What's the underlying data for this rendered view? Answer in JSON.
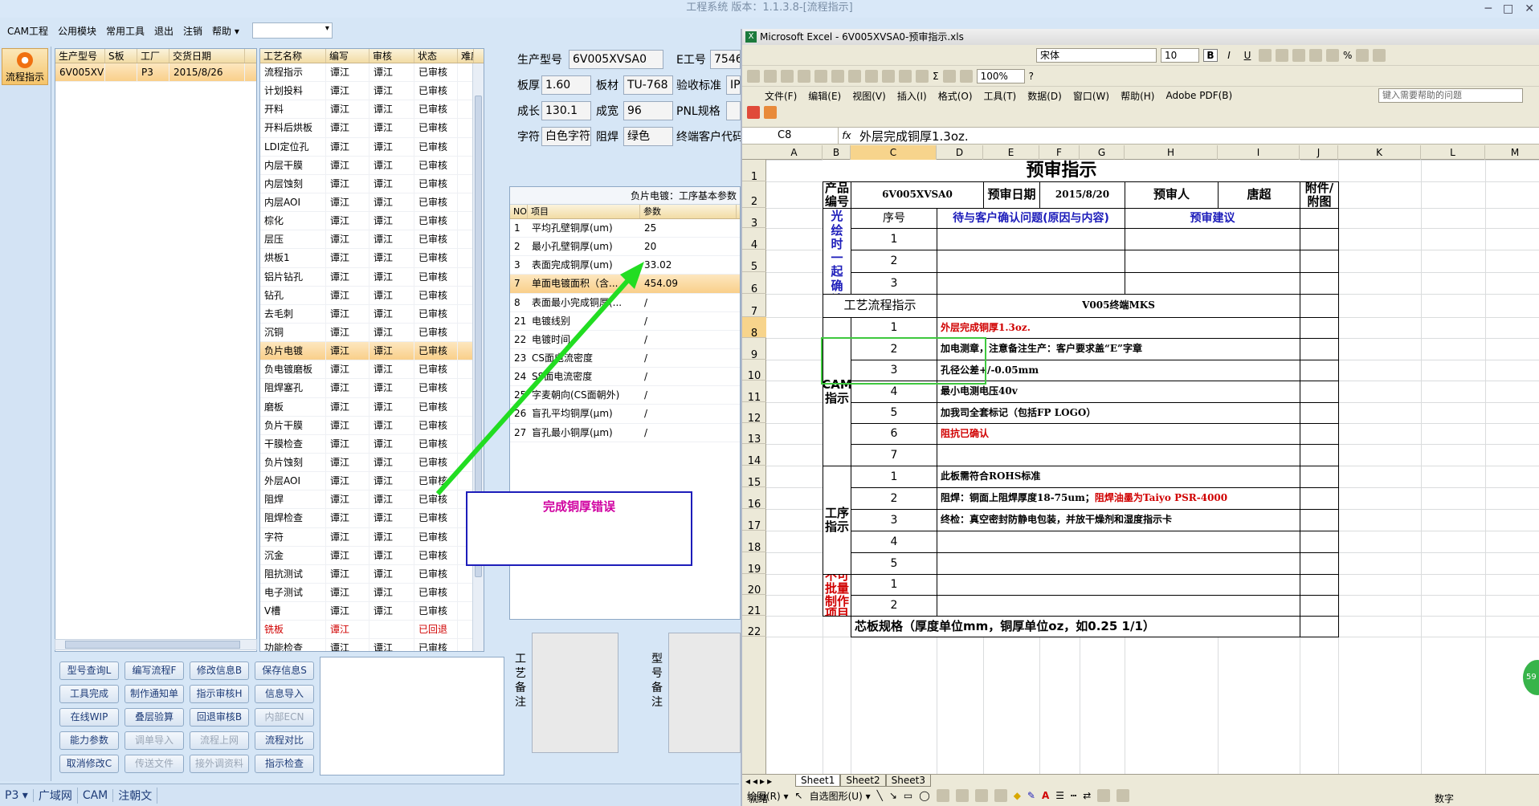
{
  "app": {
    "title": "工程系统 版本：1.1.3.8-[流程指示]",
    "menu": [
      "CAM工程",
      "公用模块",
      "常用工具",
      "退出",
      "注销",
      "帮助 ▾"
    ],
    "dropdown_value": "",
    "nav_button": "流程指示"
  },
  "product_grid": {
    "headers": [
      "生产型号",
      "S板",
      "工厂",
      "交货日期"
    ],
    "rows": [
      [
        "6V005XVSA0",
        "",
        "P3",
        "2015/8/26"
      ]
    ]
  },
  "process_grid": {
    "headers": [
      "工艺名称",
      "编写",
      "审核",
      "状态",
      "难度"
    ],
    "rows": [
      [
        "流程指示",
        "谭江",
        "谭江",
        "已审核"
      ],
      [
        "计划投料",
        "谭江",
        "谭江",
        "已审核"
      ],
      [
        "开料",
        "谭江",
        "谭江",
        "已审核"
      ],
      [
        "开料后烘板",
        "谭江",
        "谭江",
        "已审核"
      ],
      [
        "LDI定位孔",
        "谭江",
        "谭江",
        "已审核"
      ],
      [
        "内层干膜",
        "谭江",
        "谭江",
        "已审核"
      ],
      [
        "内层蚀刻",
        "谭江",
        "谭江",
        "已审核"
      ],
      [
        "内层AOI",
        "谭江",
        "谭江",
        "已审核"
      ],
      [
        "棕化",
        "谭江",
        "谭江",
        "已审核"
      ],
      [
        "层压",
        "谭江",
        "谭江",
        "已审核"
      ],
      [
        "烘板1",
        "谭江",
        "谭江",
        "已审核"
      ],
      [
        "铝片钻孔",
        "谭江",
        "谭江",
        "已审核"
      ],
      [
        "钻孔",
        "谭江",
        "谭江",
        "已审核"
      ],
      [
        "去毛刺",
        "谭江",
        "谭江",
        "已审核"
      ],
      [
        "沉铜",
        "谭江",
        "谭江",
        "已审核"
      ],
      [
        "负片电镀",
        "谭江",
        "谭江",
        "已审核"
      ],
      [
        "负电镀磨板",
        "谭江",
        "谭江",
        "已审核"
      ],
      [
        "阻焊塞孔",
        "谭江",
        "谭江",
        "已审核"
      ],
      [
        "磨板",
        "谭江",
        "谭江",
        "已审核"
      ],
      [
        "负片干膜",
        "谭江",
        "谭江",
        "已审核"
      ],
      [
        "干膜检查",
        "谭江",
        "谭江",
        "已审核"
      ],
      [
        "负片蚀刻",
        "谭江",
        "谭江",
        "已审核"
      ],
      [
        "外层AOI",
        "谭江",
        "谭江",
        "已审核"
      ],
      [
        "阻焊",
        "谭江",
        "谭江",
        "已审核"
      ],
      [
        "阻焊检查",
        "谭江",
        "谭江",
        "已审核"
      ],
      [
        "字符",
        "谭江",
        "谭江",
        "已审核"
      ],
      [
        "沉金",
        "谭江",
        "谭江",
        "已审核"
      ],
      [
        "阻抗测试",
        "谭江",
        "谭江",
        "已审核"
      ],
      [
        "电子测试",
        "谭江",
        "谭江",
        "已审核"
      ],
      [
        "V槽",
        "谭江",
        "谭江",
        "已审核"
      ],
      [
        "铣板",
        "谭江",
        "",
        "已回退"
      ],
      [
        "功能检查",
        "谭江",
        "谭江",
        "已审核"
      ]
    ],
    "selected_index": 15,
    "red_index": 30
  },
  "buttons": [
    [
      "型号查询L",
      "编写流程F",
      "修改信息B",
      "保存信息S"
    ],
    [
      "工具完成",
      "制作通知单",
      "指示审核H",
      "信息导入"
    ],
    [
      "在线WIP",
      "叠层验算",
      "回退审核B",
      "内部ECN"
    ],
    [
      "能力参数",
      "调单导入",
      "流程上网",
      "流程对比"
    ],
    [
      "取消修改C",
      "传送文件",
      "接外调资料",
      "指示检查"
    ]
  ],
  "form": {
    "labels": {
      "model": "生产型号",
      "eno": "E工号",
      "thick": "板厚",
      "mat": "板材",
      "std": "验收标准",
      "len": "成长",
      "wid": "成宽",
      "pnl": "PNL规格",
      "char": "字符",
      "mask": "阻焊",
      "cust": "终端客户代码"
    },
    "values": {
      "model": "6V005XVSA0",
      "eno": "7546",
      "thick": "1.60",
      "mat": "TU-768",
      "std": "IP",
      "len": "130.1",
      "wid": "96",
      "pnl": "",
      "char": "白色字符",
      "mask": "绿色"
    }
  },
  "params": {
    "caption": "负片电镀：工序基本参数",
    "headers": [
      "NO",
      "项目",
      "参数"
    ],
    "rows": [
      [
        "1",
        "平均孔壁铜厚(um)",
        "25"
      ],
      [
        "2",
        "最小孔壁铜厚(um)",
        "20"
      ],
      [
        "3",
        "表面完成铜厚(um)",
        "33.02"
      ],
      [
        "7",
        "单面电镀面积（含...",
        "454.09"
      ],
      [
        "8",
        "表面最小完成铜厚(...",
        "/"
      ],
      [
        "21",
        "电镀线别",
        "/"
      ],
      [
        "22",
        "电镀时间",
        "/"
      ],
      [
        "23",
        "CS面电流密度",
        "/"
      ],
      [
        "24",
        "SS面电流密度",
        "/"
      ],
      [
        "25",
        "字麦朝向(CS面朝外)",
        "/"
      ],
      [
        "26",
        "盲孔平均铜厚(μm)",
        "/"
      ],
      [
        "27",
        "盲孔最小铜厚(μm)",
        "/"
      ]
    ],
    "selected_index": 3
  },
  "notes": {
    "process_label": "工艺备注",
    "model_label": "型号备注"
  },
  "statusbar": [
    "P3 ▾",
    "广域网",
    "CAM",
    "注朝文"
  ],
  "callout": "完成铜厚错误",
  "excel": {
    "title": "Microsoft Excel - 6V005XVSA0-预审指示.xls",
    "font": "宋体",
    "size": "10",
    "zoom": "100%",
    "help_placeholder": "键入需要帮助的问题",
    "menu": [
      "文件(F)",
      "编辑(E)",
      "视图(V)",
      "插入(I)",
      "格式(O)",
      "工具(T)",
      "数据(D)",
      "窗口(W)",
      "帮助(H)",
      "Adobe PDF(B)"
    ],
    "cell_ref": "C8",
    "formula": "外层完成铜厚1.3oz.",
    "columns": [
      "A",
      "B",
      "C",
      "D",
      "E",
      "F",
      "G",
      "H",
      "I",
      "J",
      "K",
      "L",
      "M"
    ],
    "rows": [
      "1",
      "2",
      "3",
      "4",
      "5",
      "6",
      "7",
      "8",
      "9",
      "10",
      "11",
      "12",
      "13",
      "14",
      "15",
      "16",
      "17",
      "18",
      "19",
      "20",
      "21",
      "22"
    ],
    "sheet_title": "预审指示",
    "h_product": "产品编号",
    "product_no": "6V005XVSA0",
    "h_date": "预审日期",
    "date": "2015/8/20",
    "h_person": "预审人",
    "person": "唐超",
    "h_attach": "附件/附图",
    "h_seq": "序号",
    "h_question": "待与客户确认问题(原因与内容)",
    "h_suggest": "预审建议",
    "confirm_label": "待确认光绘时一起确认问题",
    "flow_label": "工艺流程指示",
    "flow_value": "V005终端MKS",
    "cam_label": "CAM指示",
    "cam_items": [
      "外层完成铜厚1.3oz.",
      "加电测章，注意备注生产：客户要求盖“E”字章",
      "孔径公差+/-0.05mm",
      "最小电测电压40v",
      "加我司全套标记（包括FP LOGO）",
      "阻抗已确认",
      ""
    ],
    "proc_label": "工序指示",
    "proc_items": [
      "此板需符合ROHS标准",
      "阻焊：铜面上阻焊厚度18-75um；",
      "检：真空密封防静电包装，并放干燥剂和湿度指示卡",
      "",
      ""
    ],
    "proc_item2_red": "阻焊油墨为Taiyo PSR-4000",
    "proc_item3_prefix": "终",
    "cannot_label": "不可批量制作项目",
    "core_spec": "芯板规格（厚度单位mm，铜厚单位oz，如0.25 1/1）",
    "sheets": [
      "Sheet1",
      "Sheet2",
      "Sheet3"
    ],
    "draw_label": "绘图(R) ▾",
    "autoshape": "自选图形(U) ▾",
    "status_left": "就绪",
    "status_right": "数字"
  },
  "badge": "59"
}
